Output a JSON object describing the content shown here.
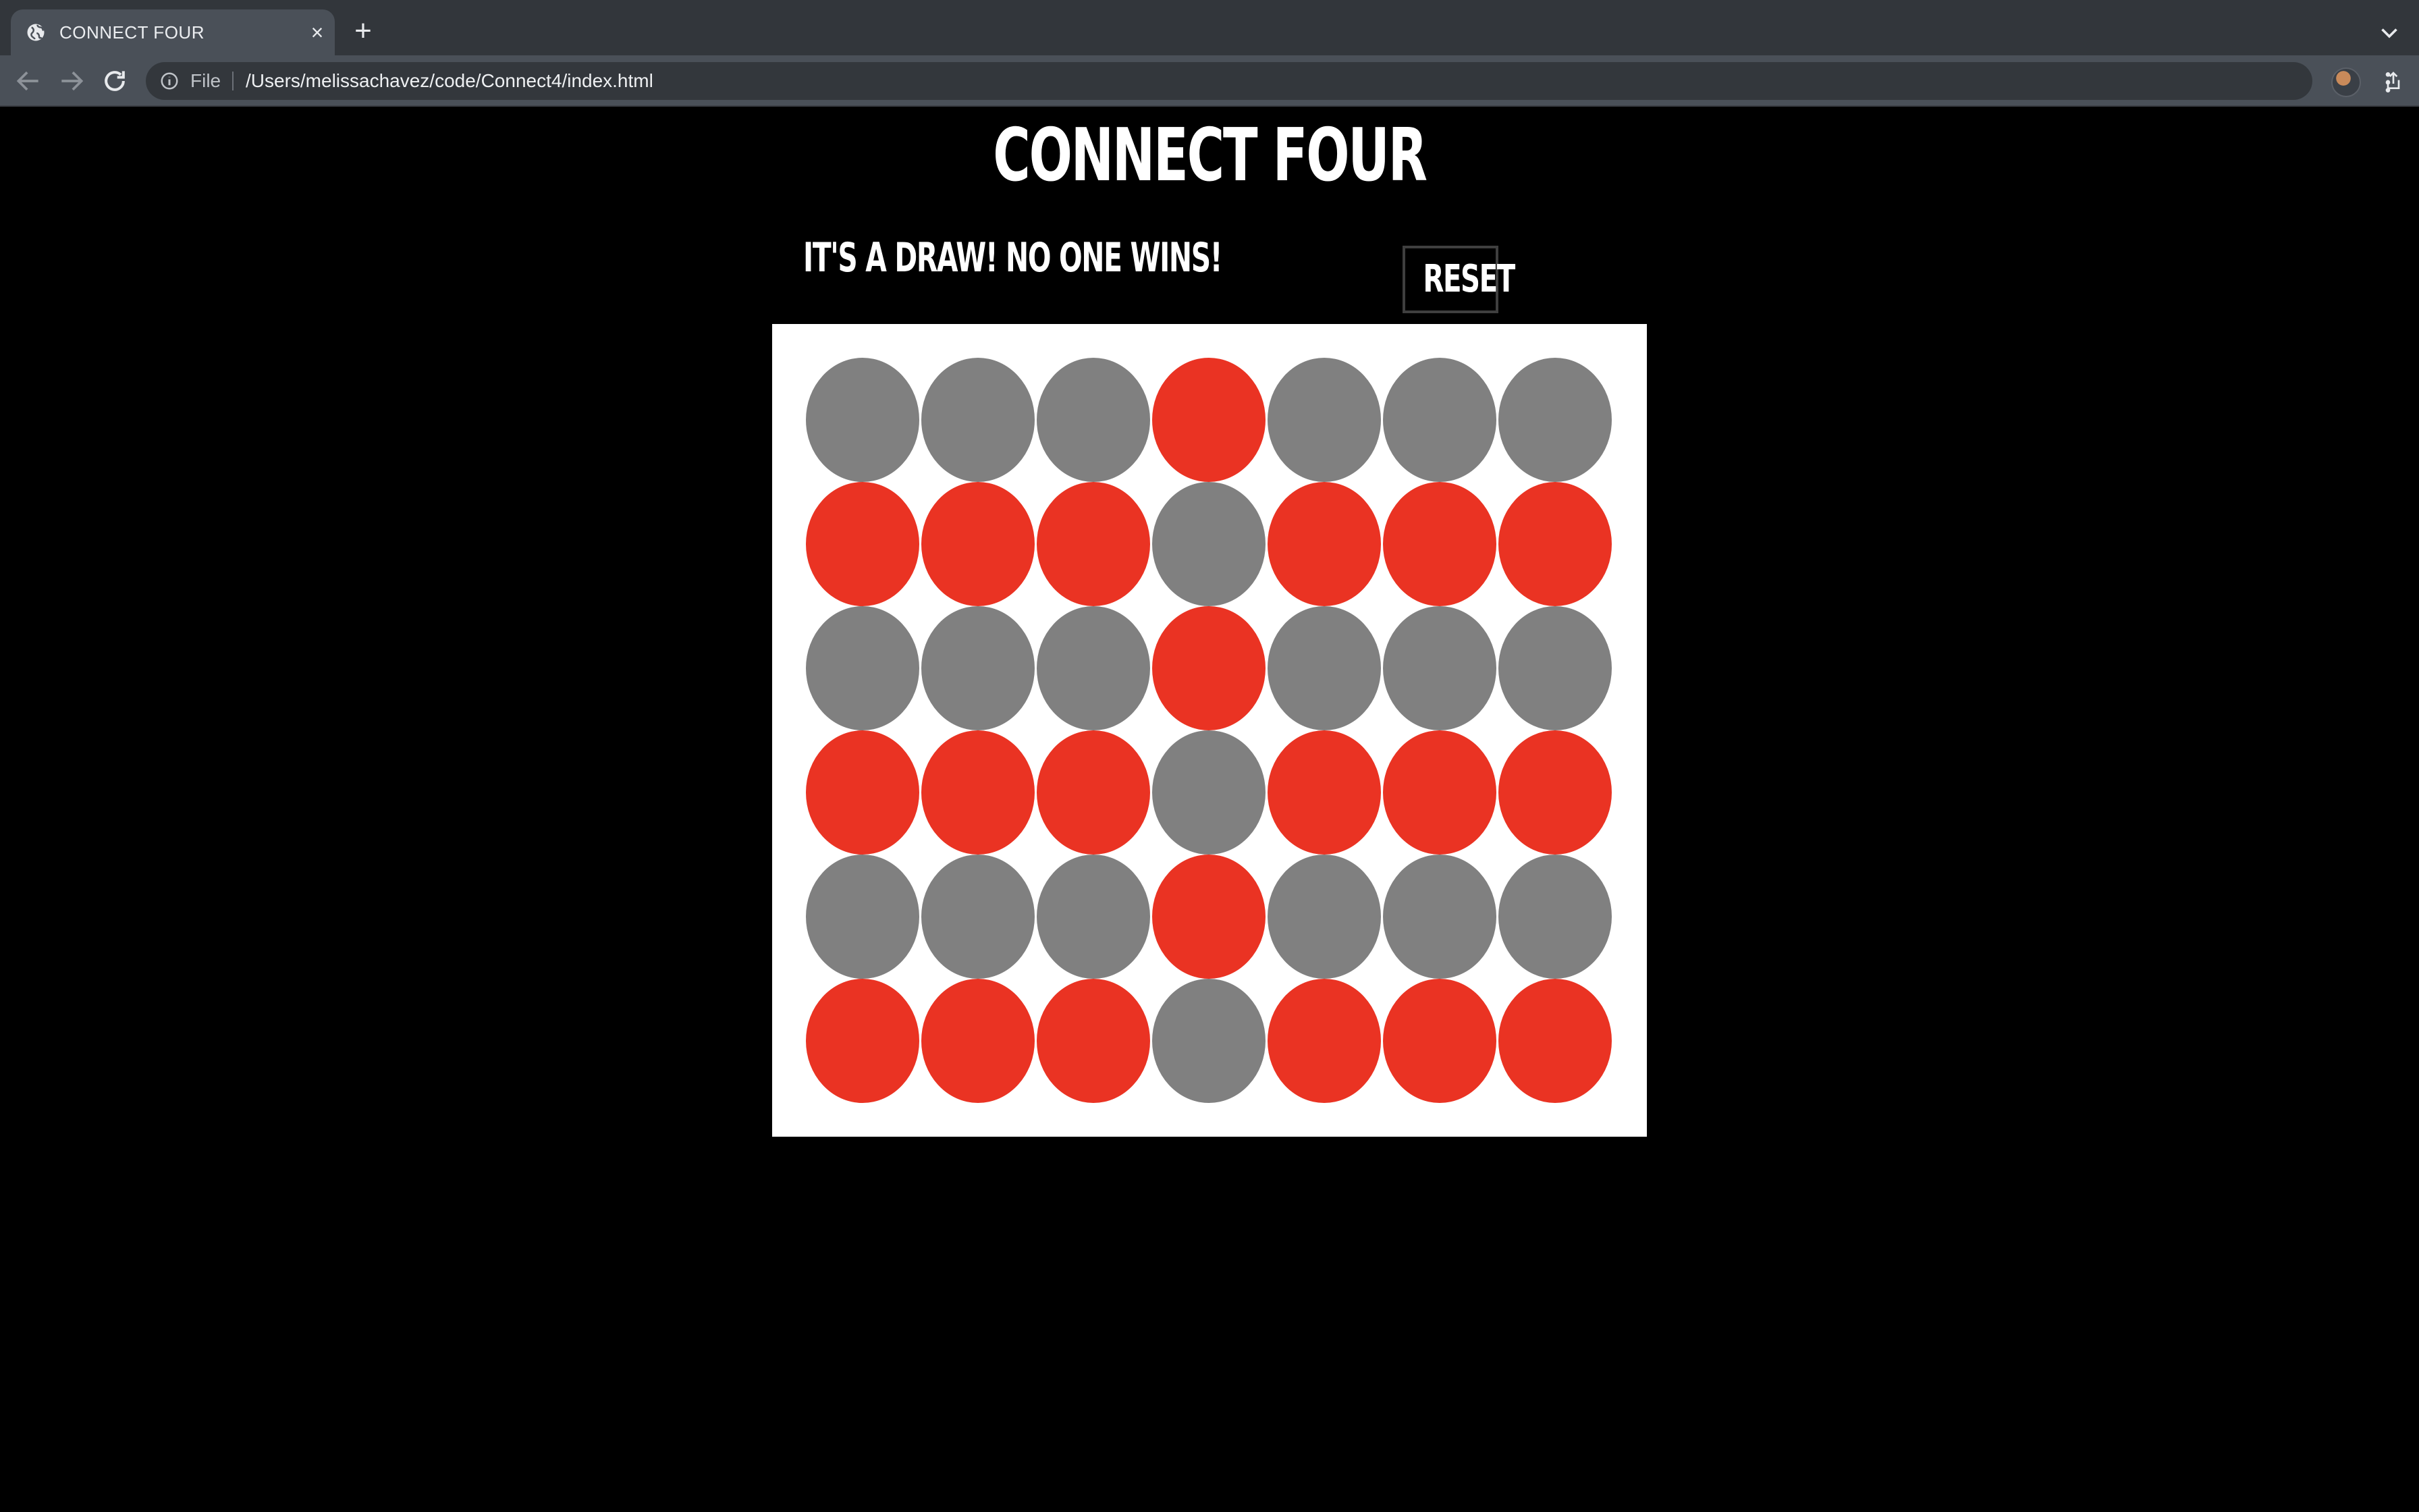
{
  "browser": {
    "tab_title": "CONNECT FOUR",
    "address_scheme": "File",
    "address_url": "/Users/melissachavez/code/Connect4/index.html"
  },
  "game": {
    "title": "CONNECT FOUR",
    "status": "IT'S A DRAW! NO ONE WINS!",
    "reset_label": "RESET",
    "colors": {
      "red": "#ea3323",
      "empty": "#808080",
      "board": "#ffffff"
    },
    "rows": [
      [
        "empty",
        "empty",
        "empty",
        "red",
        "empty",
        "empty",
        "empty"
      ],
      [
        "red",
        "red",
        "red",
        "empty",
        "red",
        "red",
        "red"
      ],
      [
        "empty",
        "empty",
        "empty",
        "red",
        "empty",
        "empty",
        "empty"
      ],
      [
        "red",
        "red",
        "red",
        "empty",
        "red",
        "red",
        "red"
      ],
      [
        "empty",
        "empty",
        "empty",
        "red",
        "empty",
        "empty",
        "empty"
      ],
      [
        "red",
        "red",
        "red",
        "empty",
        "red",
        "red",
        "red"
      ]
    ]
  }
}
